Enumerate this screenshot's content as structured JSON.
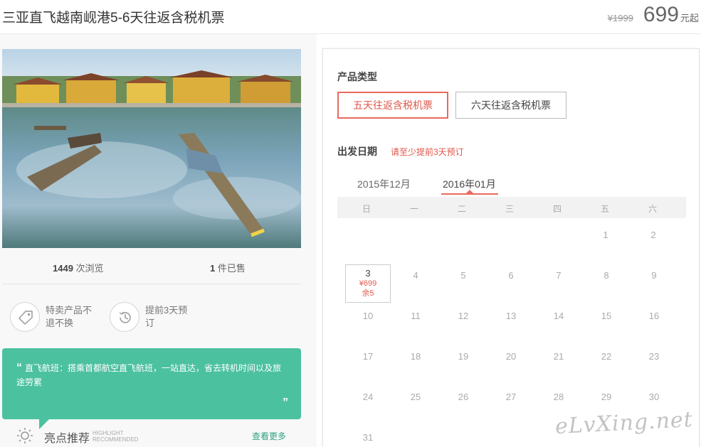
{
  "product": {
    "title": "三亚直飞越南岘港5-6天往返含税机票",
    "original_price": "¥1999",
    "price": "699",
    "price_unit": "元起"
  },
  "stats": {
    "views_num": "1449",
    "views_label": "次浏览",
    "sold_num": "1",
    "sold_label": "件已售"
  },
  "features": [
    {
      "icon": "tag-icon",
      "text": "特卖产品不退不换"
    },
    {
      "icon": "clock-icon",
      "text": "提前3天预订"
    }
  ],
  "quote": {
    "open": "“",
    "text": "直飞航班：搭乘首都航空直飞航班，一站直达，省去转机时间以及旅途劳累",
    "close": "”"
  },
  "highlight": {
    "title": "亮点推荐",
    "en_line1": "HIGHLIGHT",
    "en_line2": "RECOMMENDED",
    "more": "查看更多"
  },
  "booking": {
    "type_label": "产品类型",
    "types": [
      "五天往返含税机票",
      "六天往返含税机票"
    ],
    "selected_type": "五天往返含税机票",
    "date_label": "出发日期",
    "date_hint": "请至少提前3天预订",
    "months": [
      "2015年12月",
      "2016年01月"
    ],
    "active_month": "2016年01月",
    "weekdays": [
      "日",
      "一",
      "二",
      "三",
      "四",
      "五",
      "六"
    ],
    "selected_day": {
      "day": "3",
      "price": "¥699",
      "stock": "余5"
    }
  },
  "watermark": "eLvXing.net",
  "colors": {
    "accent": "#e86a5d",
    "teal": "#4cc1a0"
  }
}
